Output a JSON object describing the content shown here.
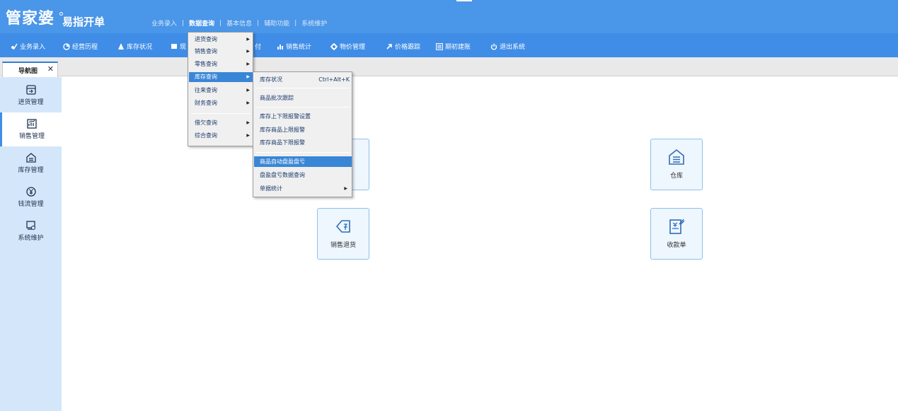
{
  "app": {
    "logo_main": "管家婆",
    "logo_sub": "易指开单"
  },
  "top_menu": {
    "items": [
      "业务录入",
      "数据查询",
      "基本信息",
      "辅助功能",
      "系统维护"
    ],
    "separator": "|",
    "active": "数据查询"
  },
  "toolbar": {
    "items": [
      {
        "label": "业务录入",
        "icon": "pen-user-icon"
      },
      {
        "label": "经营历程",
        "icon": "clock-pie-icon"
      },
      {
        "label": "库存状况",
        "icon": "flame-icon"
      },
      {
        "label": "现",
        "icon": "document-icon"
      },
      {
        "label": "付",
        "icon": "payment-icon"
      },
      {
        "label": "销售统计",
        "icon": "bar-chart-icon"
      },
      {
        "label": "物价管理",
        "icon": "gear-icon"
      },
      {
        "label": "价格跟踪",
        "icon": "arrow-up-right-icon"
      },
      {
        "label": "期初建账",
        "icon": "ledger-icon"
      },
      {
        "label": "退出系统",
        "icon": "power-icon"
      }
    ]
  },
  "nav_tab": {
    "label": "导航图",
    "close": "✕"
  },
  "sidebar": {
    "items": [
      {
        "label": "进货管理",
        "icon": "purchase-icon"
      },
      {
        "label": "销售管理",
        "icon": "sales-chart-icon",
        "active": true
      },
      {
        "label": "库存管理",
        "icon": "warehouse-icon"
      },
      {
        "label": "钱流管理",
        "icon": "yuan-coin-icon"
      },
      {
        "label": "系统维护",
        "icon": "system-settings-icon"
      }
    ]
  },
  "tiles": [
    {
      "label": "仓库",
      "icon": "warehouse-house-icon"
    },
    {
      "label": "销售退货",
      "icon": "sales-return-icon"
    },
    {
      "label": "收款单",
      "icon": "receipt-icon"
    }
  ],
  "data_query_menu": {
    "items": [
      {
        "label": "进货查询",
        "arrow": "▶"
      },
      {
        "label": "销售查询",
        "arrow": "▶"
      },
      {
        "label": "零售查询",
        "arrow": "▶"
      },
      {
        "label": "库存查询",
        "arrow": "▶",
        "selected": true
      },
      {
        "label": "往来查询",
        "arrow": "▶"
      },
      {
        "label": "财务查询",
        "arrow": "▶"
      },
      {
        "label": "借欠查询",
        "arrow": "▶"
      },
      {
        "label": "综合查询",
        "arrow": "▶"
      }
    ]
  },
  "inventory_submenu": {
    "items": [
      {
        "label": "库存状况",
        "shortcut": "Ctrl+Alt+K"
      },
      {
        "label": "商品批次跟踪"
      },
      {
        "label": "库存上下限报警设置"
      },
      {
        "label": "库存商品上限报警"
      },
      {
        "label": "库存商品下限报警"
      },
      {
        "label": "商品自动盘盈盘亏",
        "selected": true
      },
      {
        "label": "盘盈盘亏数据查询"
      },
      {
        "label": "单据统计",
        "arrow": "▶"
      }
    ]
  },
  "colors": {
    "titlebar": "#4a96e8",
    "toolbar": "#3f8de6",
    "sidebar": "#d4e6f9",
    "menu_selected": "#3a86d6",
    "tile_border": "#8ec1ec"
  }
}
